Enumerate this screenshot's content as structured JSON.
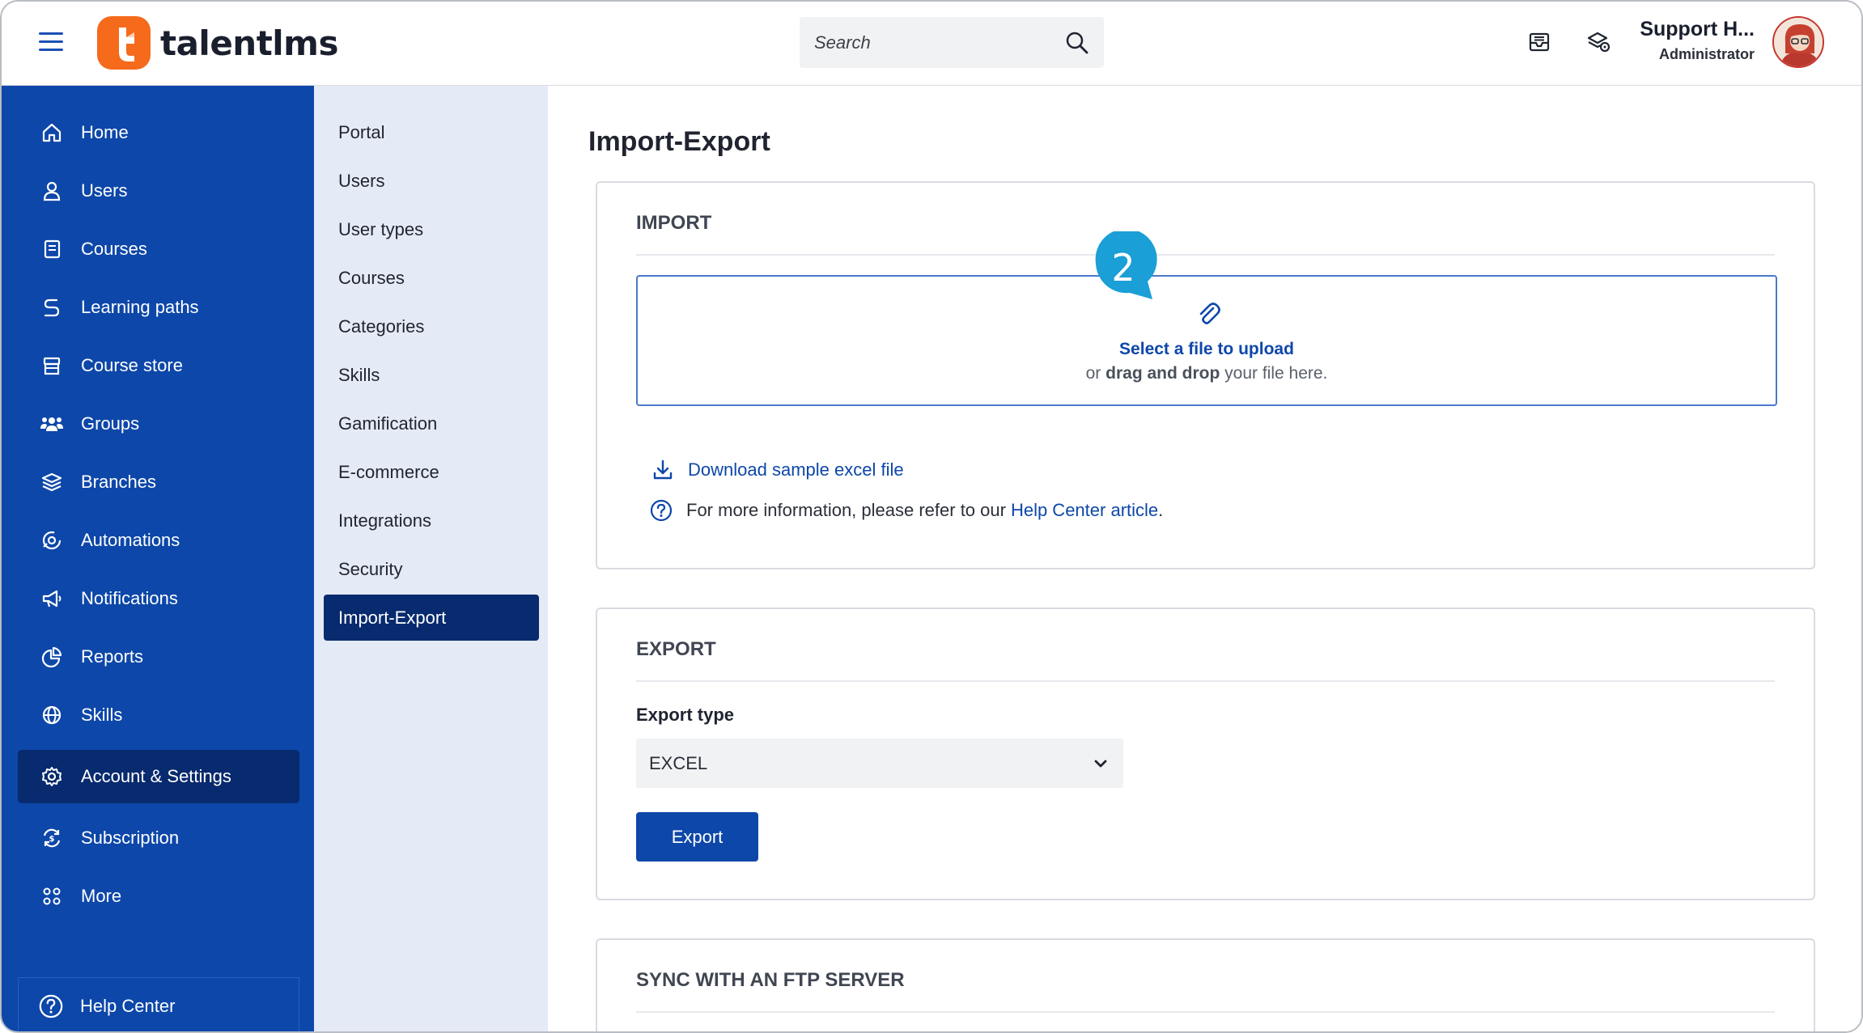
{
  "header": {
    "brand": "talentlms",
    "search_placeholder": "Search",
    "user_name": "Support H...",
    "user_role": "Administrator"
  },
  "sidebar": {
    "items": [
      {
        "label": "Home",
        "icon": "home-icon"
      },
      {
        "label": "Users",
        "icon": "user-icon"
      },
      {
        "label": "Courses",
        "icon": "book-icon"
      },
      {
        "label": "Learning paths",
        "icon": "path-icon"
      },
      {
        "label": "Course store",
        "icon": "store-icon"
      },
      {
        "label": "Groups",
        "icon": "groups-icon"
      },
      {
        "label": "Branches",
        "icon": "layers-icon"
      },
      {
        "label": "Automations",
        "icon": "automation-icon"
      },
      {
        "label": "Notifications",
        "icon": "megaphone-icon"
      },
      {
        "label": "Reports",
        "icon": "pie-chart-icon"
      },
      {
        "label": "Skills",
        "icon": "globe-icon"
      },
      {
        "label": "Account & Settings",
        "icon": "gear-icon",
        "active": true
      },
      {
        "label": "Subscription",
        "icon": "subscription-icon"
      },
      {
        "label": "More",
        "icon": "grid-icon"
      }
    ],
    "help_center": "Help Center"
  },
  "submenu": {
    "items": [
      "Portal",
      "Users",
      "User types",
      "Courses",
      "Categories",
      "Skills",
      "Gamification",
      "E-commerce",
      "Integrations",
      "Security",
      "Import-Export"
    ],
    "active": "Import-Export"
  },
  "main": {
    "title": "Import-Export",
    "import": {
      "title": "IMPORT",
      "upload_title": "Select a file to upload",
      "upload_sub_prefix": "or",
      "upload_sub_bold": "drag and drop",
      "upload_sub_suffix": "your file here.",
      "download_link": "Download sample excel file",
      "info_text": "For more information, please refer to our",
      "info_link": "Help Center article",
      "info_end": "."
    },
    "step_badge": "2",
    "export": {
      "title": "EXPORT",
      "type_label": "Export type",
      "type_value": "EXCEL",
      "button": "Export"
    },
    "ftp": {
      "title": "SYNC WITH AN FTP SERVER"
    }
  },
  "colors": {
    "primary": "#0d47a9",
    "active_nav": "#082a6e",
    "brand_orange": "#f56a1b",
    "badge": "#1a9fd6"
  }
}
